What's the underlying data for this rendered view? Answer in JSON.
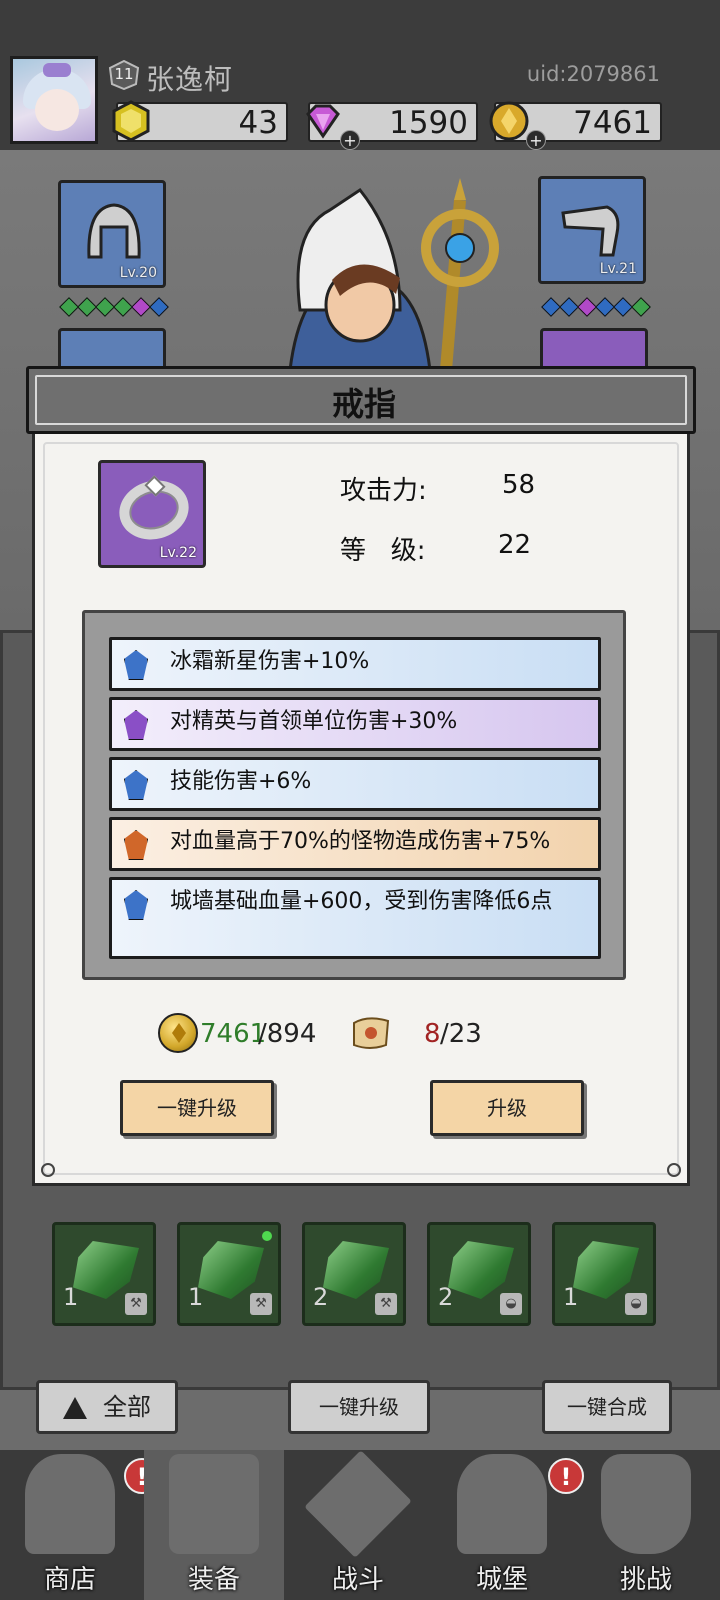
{
  "header": {
    "player_level": "11",
    "username": "张逸柯",
    "uid": "uid:2079861",
    "resources": [
      {
        "name": "gold-hex",
        "value": "43",
        "color": "#d6c021"
      },
      {
        "name": "diamond",
        "value": "1590",
        "color": "#c75ad6"
      },
      {
        "name": "coin",
        "value": "7461",
        "color": "#d9a92b"
      }
    ]
  },
  "equipment_slots": {
    "left_top": {
      "icon": "helmet-icon",
      "level": "Lv.20",
      "gems": [
        "#3fa34d",
        "#3fa34d",
        "#3fa34d",
        "#3fa34d",
        "#b149c8",
        "#2f6bc1"
      ]
    },
    "right_top": {
      "icon": "glove-icon",
      "level": "Lv.21",
      "gems": [
        "#2f6bc1",
        "#2f6bc1",
        "#b149c8",
        "#2f6bc1",
        "#2f6bc1",
        "#3fa34d"
      ]
    }
  },
  "dialog": {
    "title": "戒指",
    "item_level": "Lv.22",
    "stats": [
      {
        "label": "攻击力:",
        "value": "58"
      },
      {
        "label": "等   级:",
        "value": "22"
      }
    ],
    "affixes": [
      {
        "text": "冰霜新星伤害+10%",
        "color": "blue"
      },
      {
        "text": "对精英与首领单位伤害+30%",
        "color": "purple"
      },
      {
        "text": "技能伤害+6%",
        "color": "blue"
      },
      {
        "text": "对血量高于70%的怪物造成伤害+75%",
        "color": "orange"
      },
      {
        "text": "城墙基础血量+600，受到伤害降低6点",
        "color": "blue"
      }
    ],
    "cost": {
      "coins_have": "7461",
      "coins_need": "/894",
      "scroll_have": "8",
      "scroll_need": "/23"
    },
    "buttons": {
      "upgrade_all": "一键升级",
      "upgrade": "升级"
    }
  },
  "inventory": [
    {
      "count": "1",
      "tag": "⚒"
    },
    {
      "count": "1",
      "tag": "⚒"
    },
    {
      "count": "2",
      "tag": "⚒"
    },
    {
      "count": "2",
      "tag": "◒"
    },
    {
      "count": "1",
      "tag": "◒"
    }
  ],
  "bottom_buttons": {
    "filter": "全部",
    "upgrade_all": "一键升级",
    "merge_all": "一键合成"
  },
  "nav": [
    {
      "label": "商店",
      "alert": "!"
    },
    {
      "label": "装备",
      "alert": ""
    },
    {
      "label": "战斗",
      "alert": ""
    },
    {
      "label": "城堡",
      "alert": "!"
    },
    {
      "label": "挑战",
      "alert": ""
    }
  ]
}
